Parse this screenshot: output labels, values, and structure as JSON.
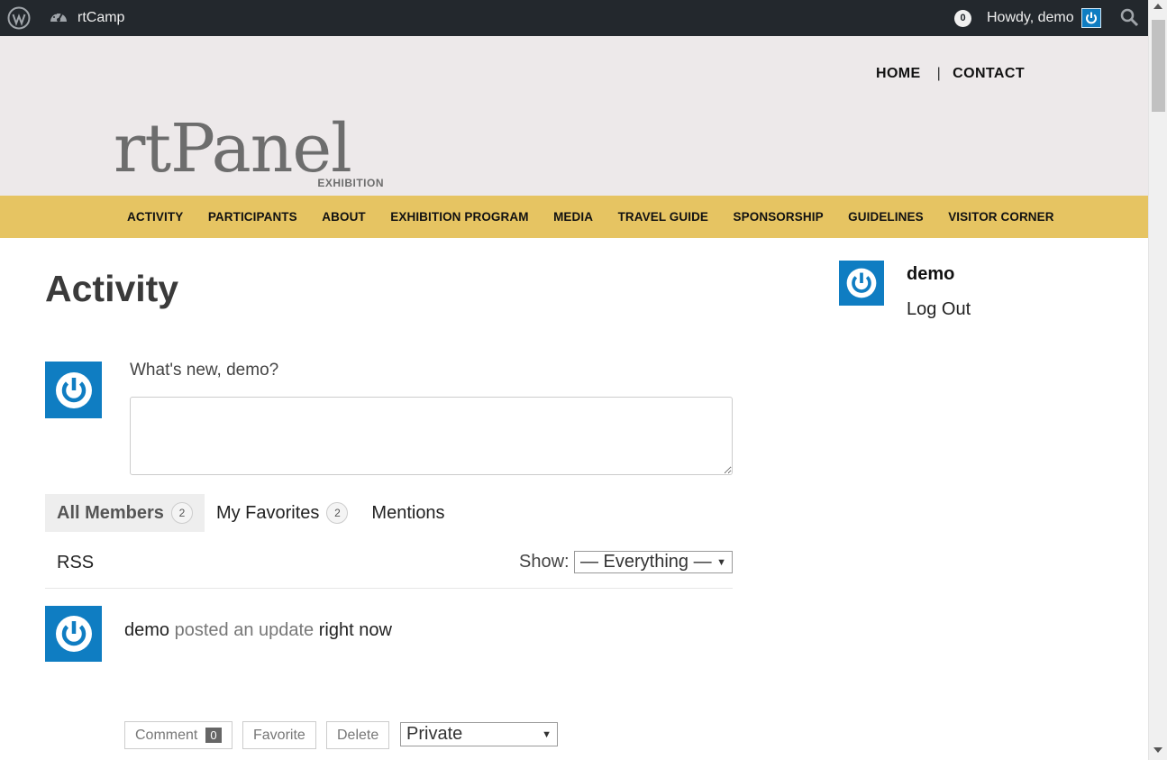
{
  "adminbar": {
    "site_name": "rtCamp",
    "notification_count": "0",
    "howdy": "Howdy, demo"
  },
  "header": {
    "top_nav": [
      "HOME",
      "CONTACT"
    ],
    "top_nav_separator": "|",
    "logo_text": "rtPanel",
    "logo_subtext": "EXHIBITION"
  },
  "main_nav": [
    "ACTIVITY",
    "PARTICIPANTS",
    "ABOUT",
    "EXHIBITION PROGRAM",
    "MEDIA",
    "TRAVEL GUIDE",
    "SPONSORSHIP",
    "GUIDELINES",
    "VISITOR CORNER"
  ],
  "page": {
    "title": "Activity",
    "whats_new": "What's new, demo?",
    "textarea_value": ""
  },
  "tabs": [
    {
      "label": "All Members",
      "count": "2"
    },
    {
      "label": "My Favorites",
      "count": "2"
    },
    {
      "label": "Mentions"
    }
  ],
  "filter": {
    "rss": "RSS",
    "show_label": "Show:",
    "show_value": "— Everything —"
  },
  "activity": {
    "user": "demo",
    "action": "posted an update",
    "time": "right now",
    "buttons": {
      "comment": "Comment",
      "comment_count": "0",
      "favorite": "Favorite",
      "delete": "Delete"
    },
    "privacy_value": "Private"
  },
  "sidebar": {
    "name": "demo",
    "logout": "Log Out"
  },
  "colors": {
    "adminbar": "#23282d",
    "header_bg": "#ede9ea",
    "nav_bg": "#e6c462",
    "avatar_blue": "#0f7dc2"
  },
  "icons": [
    "wordpress-icon",
    "dashboard-icon",
    "power-avatar-icon",
    "search-icon"
  ]
}
